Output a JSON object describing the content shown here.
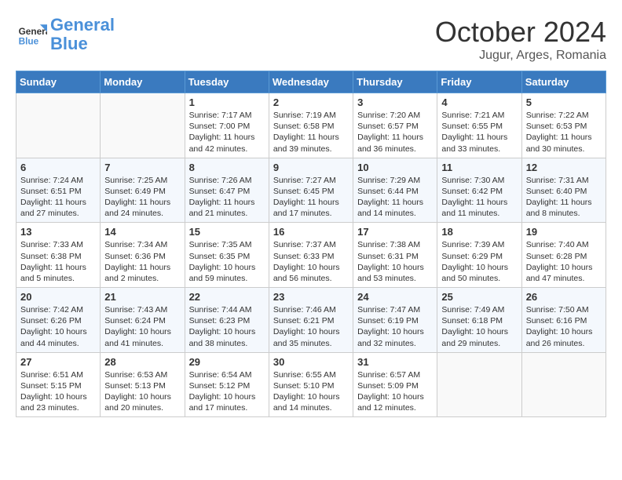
{
  "header": {
    "logo_line1": "General",
    "logo_line2": "Blue",
    "month": "October 2024",
    "location": "Jugur, Arges, Romania"
  },
  "days_of_week": [
    "Sunday",
    "Monday",
    "Tuesday",
    "Wednesday",
    "Thursday",
    "Friday",
    "Saturday"
  ],
  "weeks": [
    [
      {
        "day": "",
        "info": ""
      },
      {
        "day": "",
        "info": ""
      },
      {
        "day": "1",
        "info": "Sunrise: 7:17 AM\nSunset: 7:00 PM\nDaylight: 11 hours and 42 minutes."
      },
      {
        "day": "2",
        "info": "Sunrise: 7:19 AM\nSunset: 6:58 PM\nDaylight: 11 hours and 39 minutes."
      },
      {
        "day": "3",
        "info": "Sunrise: 7:20 AM\nSunset: 6:57 PM\nDaylight: 11 hours and 36 minutes."
      },
      {
        "day": "4",
        "info": "Sunrise: 7:21 AM\nSunset: 6:55 PM\nDaylight: 11 hours and 33 minutes."
      },
      {
        "day": "5",
        "info": "Sunrise: 7:22 AM\nSunset: 6:53 PM\nDaylight: 11 hours and 30 minutes."
      }
    ],
    [
      {
        "day": "6",
        "info": "Sunrise: 7:24 AM\nSunset: 6:51 PM\nDaylight: 11 hours and 27 minutes."
      },
      {
        "day": "7",
        "info": "Sunrise: 7:25 AM\nSunset: 6:49 PM\nDaylight: 11 hours and 24 minutes."
      },
      {
        "day": "8",
        "info": "Sunrise: 7:26 AM\nSunset: 6:47 PM\nDaylight: 11 hours and 21 minutes."
      },
      {
        "day": "9",
        "info": "Sunrise: 7:27 AM\nSunset: 6:45 PM\nDaylight: 11 hours and 17 minutes."
      },
      {
        "day": "10",
        "info": "Sunrise: 7:29 AM\nSunset: 6:44 PM\nDaylight: 11 hours and 14 minutes."
      },
      {
        "day": "11",
        "info": "Sunrise: 7:30 AM\nSunset: 6:42 PM\nDaylight: 11 hours and 11 minutes."
      },
      {
        "day": "12",
        "info": "Sunrise: 7:31 AM\nSunset: 6:40 PM\nDaylight: 11 hours and 8 minutes."
      }
    ],
    [
      {
        "day": "13",
        "info": "Sunrise: 7:33 AM\nSunset: 6:38 PM\nDaylight: 11 hours and 5 minutes."
      },
      {
        "day": "14",
        "info": "Sunrise: 7:34 AM\nSunset: 6:36 PM\nDaylight: 11 hours and 2 minutes."
      },
      {
        "day": "15",
        "info": "Sunrise: 7:35 AM\nSunset: 6:35 PM\nDaylight: 10 hours and 59 minutes."
      },
      {
        "day": "16",
        "info": "Sunrise: 7:37 AM\nSunset: 6:33 PM\nDaylight: 10 hours and 56 minutes."
      },
      {
        "day": "17",
        "info": "Sunrise: 7:38 AM\nSunset: 6:31 PM\nDaylight: 10 hours and 53 minutes."
      },
      {
        "day": "18",
        "info": "Sunrise: 7:39 AM\nSunset: 6:29 PM\nDaylight: 10 hours and 50 minutes."
      },
      {
        "day": "19",
        "info": "Sunrise: 7:40 AM\nSunset: 6:28 PM\nDaylight: 10 hours and 47 minutes."
      }
    ],
    [
      {
        "day": "20",
        "info": "Sunrise: 7:42 AM\nSunset: 6:26 PM\nDaylight: 10 hours and 44 minutes."
      },
      {
        "day": "21",
        "info": "Sunrise: 7:43 AM\nSunset: 6:24 PM\nDaylight: 10 hours and 41 minutes."
      },
      {
        "day": "22",
        "info": "Sunrise: 7:44 AM\nSunset: 6:23 PM\nDaylight: 10 hours and 38 minutes."
      },
      {
        "day": "23",
        "info": "Sunrise: 7:46 AM\nSunset: 6:21 PM\nDaylight: 10 hours and 35 minutes."
      },
      {
        "day": "24",
        "info": "Sunrise: 7:47 AM\nSunset: 6:19 PM\nDaylight: 10 hours and 32 minutes."
      },
      {
        "day": "25",
        "info": "Sunrise: 7:49 AM\nSunset: 6:18 PM\nDaylight: 10 hours and 29 minutes."
      },
      {
        "day": "26",
        "info": "Sunrise: 7:50 AM\nSunset: 6:16 PM\nDaylight: 10 hours and 26 minutes."
      }
    ],
    [
      {
        "day": "27",
        "info": "Sunrise: 6:51 AM\nSunset: 5:15 PM\nDaylight: 10 hours and 23 minutes."
      },
      {
        "day": "28",
        "info": "Sunrise: 6:53 AM\nSunset: 5:13 PM\nDaylight: 10 hours and 20 minutes."
      },
      {
        "day": "29",
        "info": "Sunrise: 6:54 AM\nSunset: 5:12 PM\nDaylight: 10 hours and 17 minutes."
      },
      {
        "day": "30",
        "info": "Sunrise: 6:55 AM\nSunset: 5:10 PM\nDaylight: 10 hours and 14 minutes."
      },
      {
        "day": "31",
        "info": "Sunrise: 6:57 AM\nSunset: 5:09 PM\nDaylight: 10 hours and 12 minutes."
      },
      {
        "day": "",
        "info": ""
      },
      {
        "day": "",
        "info": ""
      }
    ]
  ]
}
